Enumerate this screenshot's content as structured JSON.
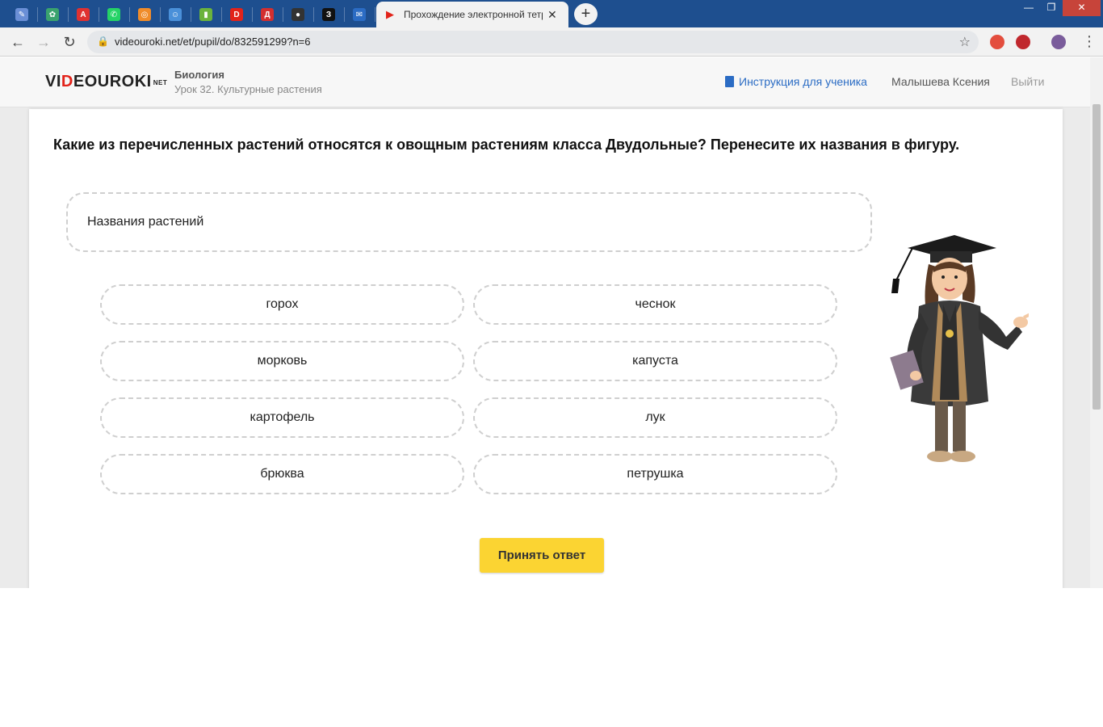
{
  "browser": {
    "active_tab_title": "Прохождение электронной тетради",
    "close_glyph": "✕",
    "new_tab_glyph": "+",
    "url": "videouroki.net/et/pupil/do/832591299?n=6",
    "pinned_tabs": [
      {
        "icon": "pen-app-icon",
        "color": "#6a8fd6",
        "glyph": "✎"
      },
      {
        "icon": "gear-green-icon",
        "color": "#3aa36e",
        "glyph": "✿"
      },
      {
        "icon": "avito-icon",
        "color": "#e03131",
        "glyph": "A"
      },
      {
        "icon": "whatsapp-icon",
        "color": "#25d366",
        "glyph": "✆"
      },
      {
        "icon": "orange-target-icon",
        "color": "#f08c2a",
        "glyph": "◎"
      },
      {
        "icon": "mascot-icon",
        "color": "#4a90d9",
        "glyph": "☺"
      },
      {
        "icon": "book-green-icon",
        "color": "#6bb33c",
        "glyph": "▮"
      },
      {
        "icon": "videouroki-icon",
        "color": "#e2231a",
        "glyph": "D"
      },
      {
        "icon": "dnevnik-icon",
        "color": "#d32f2f",
        "glyph": "Д"
      },
      {
        "icon": "panda-icon",
        "color": "#333333",
        "glyph": "●"
      },
      {
        "icon": "znanija-icon",
        "color": "#111111",
        "glyph": "З"
      },
      {
        "icon": "mail-icon",
        "color": "#2b6cc4",
        "glyph": "✉"
      }
    ]
  },
  "header": {
    "logo_a": "VI",
    "logo_b": "D",
    "logo_c": "EOUROKI",
    "logo_net": "NET",
    "subject": "Биология",
    "lesson": "Урок 32. Культурные растения",
    "instructions_link": "Инструкция для ученика",
    "user_name": "Малышева Ксения",
    "logout": "Выйти"
  },
  "task": {
    "question": "Какие из перечисленных растений относятся к овощным растениям класса Двудольные? Перенесите их названия в фигуру.",
    "dropzone_label": "Названия растений",
    "options": [
      "горох",
      "чеснок",
      "морковь",
      "капуста",
      "картофель",
      "лук",
      "брюква",
      "петрушка"
    ],
    "submit_label": "Принять ответ"
  },
  "colors": {
    "accent_button": "#fbd432",
    "link": "#2b6cc4",
    "brand_red": "#e2231a",
    "tabbar": "#1e4f8f"
  }
}
